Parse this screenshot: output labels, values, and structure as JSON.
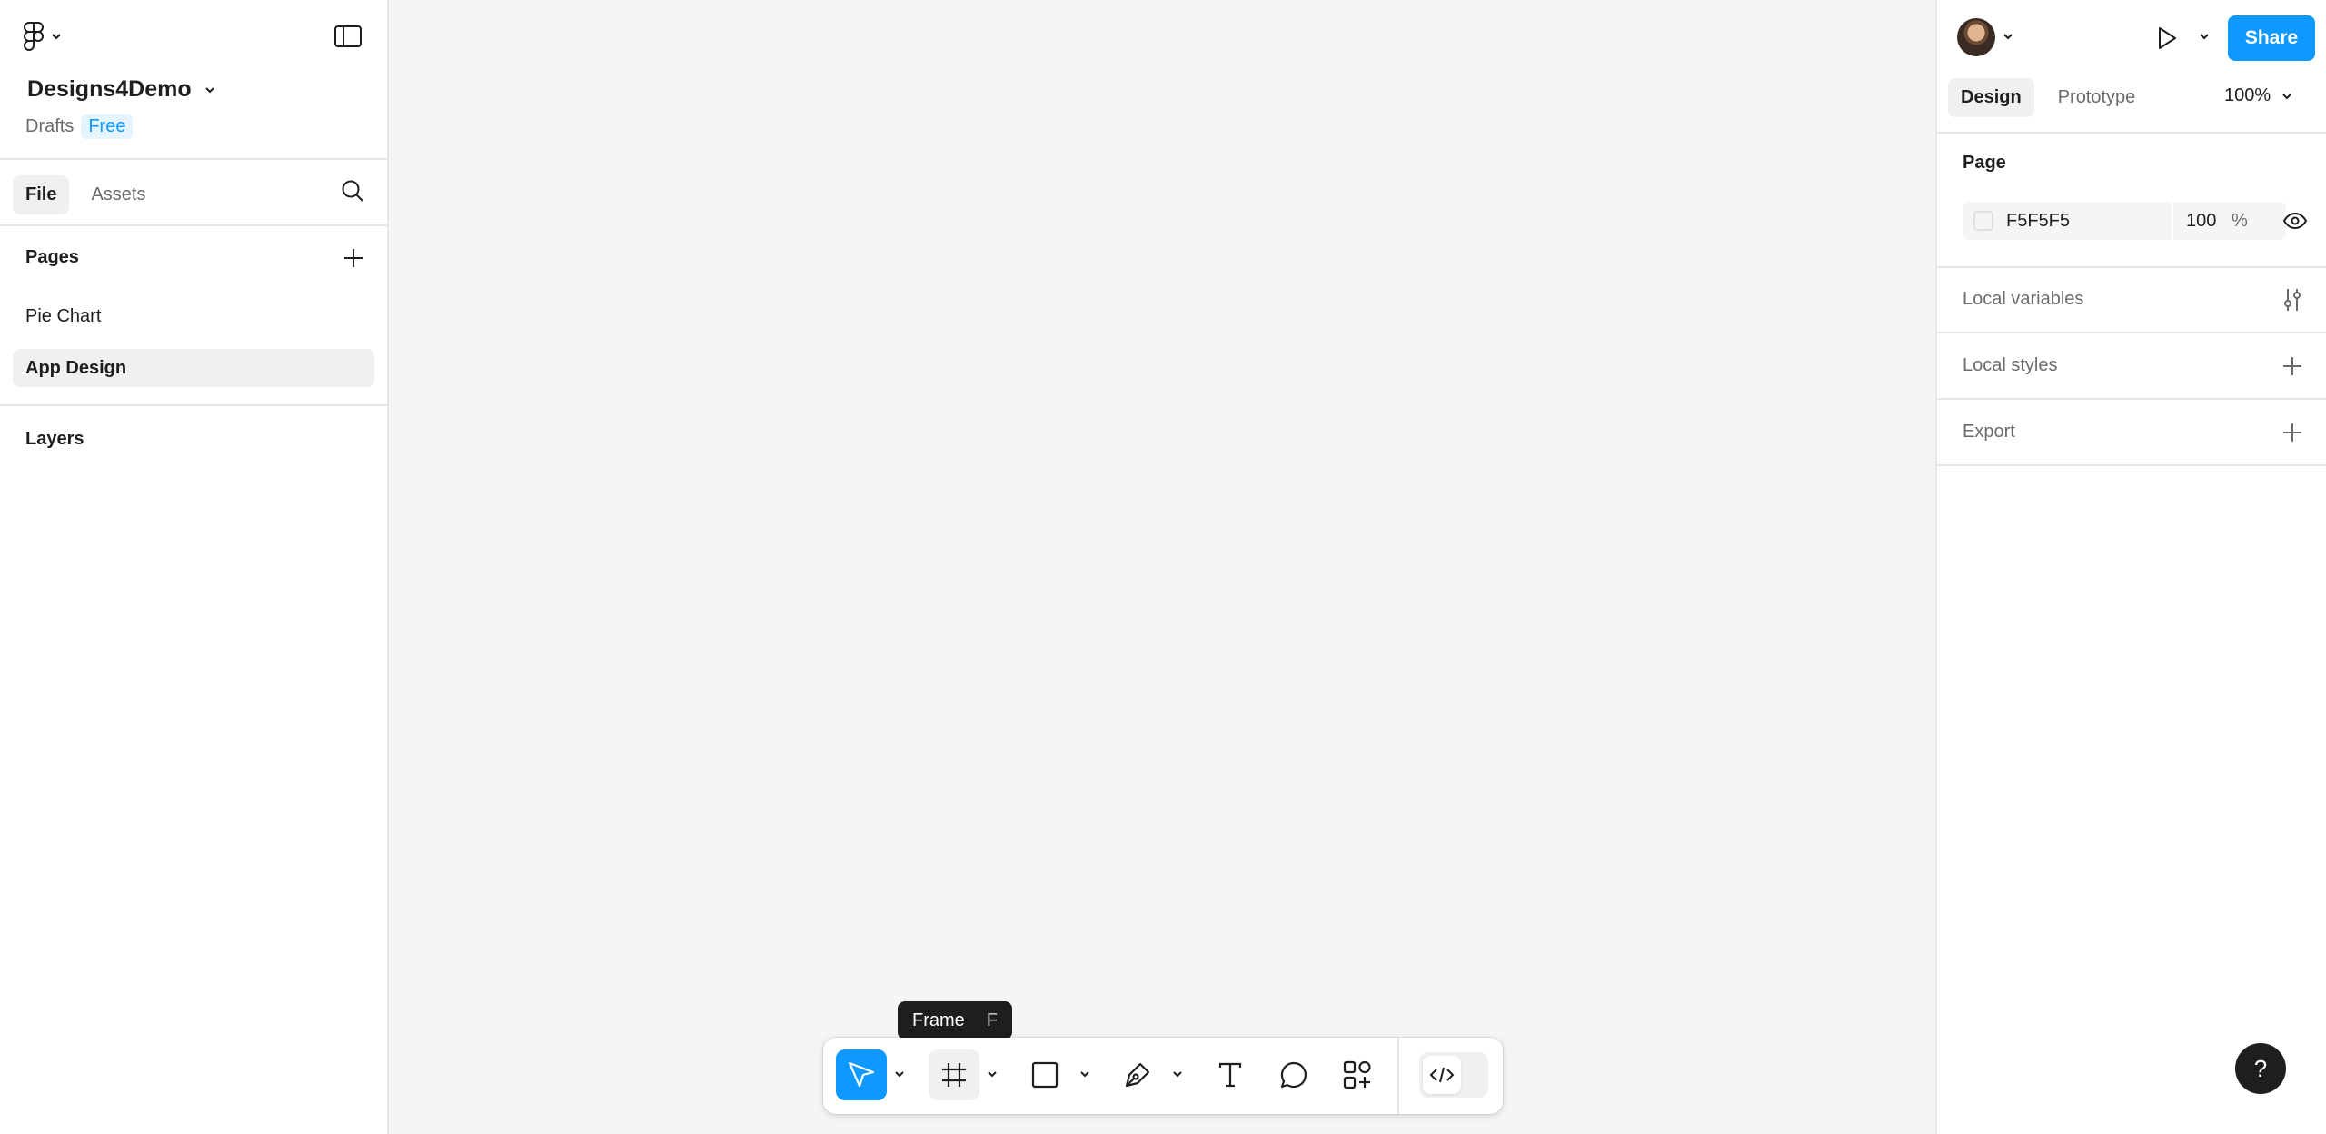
{
  "left_panel": {
    "file_name": "Designs4Demo",
    "location": "Drafts",
    "plan_badge": "Free",
    "tabs": [
      {
        "label": "File"
      },
      {
        "label": "Assets"
      }
    ],
    "pages_title": "Pages",
    "pages": [
      {
        "label": "Pie Chart"
      },
      {
        "label": "App Design"
      }
    ],
    "layers_title": "Layers"
  },
  "right_panel": {
    "share_label": "Share",
    "tabs": [
      {
        "label": "Design"
      },
      {
        "label": "Prototype"
      }
    ],
    "zoom": "100%",
    "page_section": {
      "title": "Page",
      "background_hex": "F5F5F5",
      "opacity": "100",
      "opacity_unit": "%"
    },
    "local_variables": "Local variables",
    "local_styles": "Local styles",
    "export": "Export"
  },
  "toolbar": {
    "tooltip_label": "Frame",
    "tooltip_shortcut": "F"
  },
  "help": {
    "label": "?"
  },
  "colors": {
    "accent": "#0d99ff",
    "canvas": "#f5f5f5",
    "tooltip_bg": "#1e1e1e"
  }
}
